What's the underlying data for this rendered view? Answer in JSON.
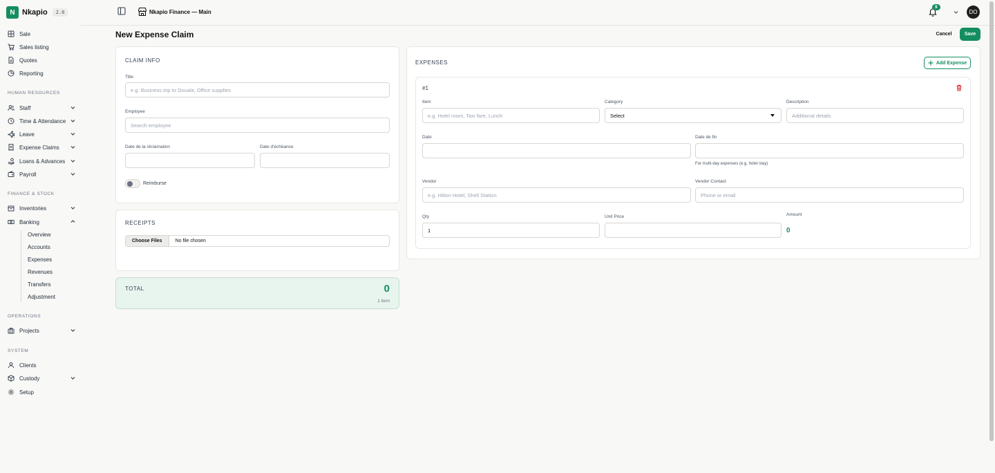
{
  "brand": {
    "logo_letter": "N",
    "name": "Nkapio",
    "version": "2.0"
  },
  "sidebar": {
    "top_items": [
      {
        "label": "Sale",
        "icon": "grid-icon"
      },
      {
        "label": "Sales listing",
        "icon": "cart-icon"
      },
      {
        "label": "Quotes",
        "icon": "document-icon"
      },
      {
        "label": "Reporting",
        "icon": "chart-pie-icon"
      }
    ],
    "sections": {
      "hr": "HUMAN RESOURCES",
      "finance": "FINANCE & STOCK",
      "operations": "OPERATIONS",
      "system": "SYSTEM"
    },
    "hr_items": [
      {
        "label": "Staff",
        "icon": "users-icon"
      },
      {
        "label": "Time & Attendance",
        "icon": "clock-icon"
      },
      {
        "label": "Leave",
        "icon": "plane-icon"
      },
      {
        "label": "Expense Claims",
        "icon": "receipt-icon"
      },
      {
        "label": "Loans & Advances",
        "icon": "hand-coins-icon"
      },
      {
        "label": "Payroll",
        "icon": "wallet-icon"
      }
    ],
    "finance_items": [
      {
        "label": "Inventories",
        "icon": "box-icon"
      },
      {
        "label": "Banking",
        "icon": "banknote-icon"
      }
    ],
    "banking_sub": [
      "Overview",
      "Accounts",
      "Expenses",
      "Revenues",
      "Transfers",
      "Adjustment"
    ],
    "operations_items": [
      {
        "label": "Projects",
        "icon": "briefcase-icon"
      }
    ],
    "system_items": [
      {
        "label": "Clients",
        "icon": "user-icon"
      },
      {
        "label": "Custody",
        "icon": "package-icon"
      },
      {
        "label": "Setup",
        "icon": "gear-icon"
      }
    ]
  },
  "topbar": {
    "store_name": "Nkapio Finance — Main",
    "notifications": "9",
    "avatar": "DO"
  },
  "page": {
    "title": "New Expense Claim",
    "cancel": "Cancel",
    "save": "Save"
  },
  "claim_info": {
    "title": "CLAIM INFO",
    "title_label": "Title",
    "title_placeholder": "e.g. Business trip to Douala, Office supplies",
    "employee_label": "Employee",
    "employee_placeholder": "Search employee",
    "claim_date_label": "Date de la réclamation",
    "due_date_label": "Date d'échéance",
    "reimburse_label": "Reimburse"
  },
  "receipts": {
    "title": "RECEIPTS",
    "choose_files": "Choose Files",
    "no_file": "No file chosen"
  },
  "total": {
    "label": "TOTAL",
    "value": "0",
    "items": "1 item"
  },
  "expenses": {
    "title": "EXPENSES",
    "add_button": "Add Expense",
    "items": [
      {
        "number": "#1",
        "item_label": "Item",
        "item_placeholder": "e.g. Hotel room, Taxi fare, Lunch",
        "category_label": "Category",
        "category_value": "Select",
        "description_label": "Description",
        "description_placeholder": "Additional details",
        "date_label": "Date",
        "end_date_label": "Date de fin",
        "end_date_hint": "For multi-day expenses (e.g. hotel stay)",
        "vendor_label": "Vendor",
        "vendor_placeholder": "e.g. Hilton Hotel, Shell Station",
        "vendor_contact_label": "Vendor Contact",
        "vendor_contact_placeholder": "Phone or email",
        "qty_label": "Qty",
        "qty_value": "1",
        "unit_price_label": "Unit Price",
        "amount_label": "Amount",
        "amount_value": "0"
      }
    ]
  },
  "colors": {
    "accent": "#148e60",
    "danger": "#dc2626",
    "total_bg": "#e8f4ee"
  }
}
